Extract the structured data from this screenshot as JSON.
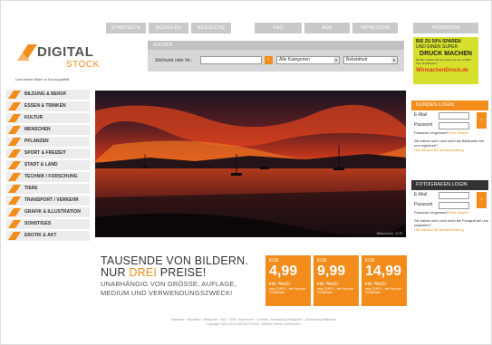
{
  "topnav": {
    "tabs": [
      "STARTSEITE",
      "BEZAHLEN",
      "BILDSUCHE",
      "FAQ",
      "AGB",
      "IMPRESSUM"
    ],
    "promo_tab": "PROMOTION"
  },
  "logo": {
    "word1": "DIGITAL",
    "word2": "STOCK",
    "tagline": "Lizenzfreie Bilder in Druckqualität"
  },
  "search": {
    "header": "SUCHEN",
    "label": "Stichwort oder Nr.:",
    "input_value": "",
    "category_select": "Alle Kategorien",
    "sort_select": "Beliebtheit"
  },
  "promo": {
    "line1": "BIS ZU 50% SPAREN",
    "line2": "UND EINEN SUPER",
    "line3": "DRUCK MACHEN",
    "line4": "Mit Wir-machen-Druck sparen Sie bis zu 50% Ihrer Druckkosten.",
    "brand": "WirmachenDruck.de"
  },
  "categories": [
    "BILDUNG & BERUF",
    "ESSEN & TRINKEN",
    "KULTUR",
    "MENSCHEN",
    "PFLANZEN",
    "SPORT & FREIZEIT",
    "STADT & LAND",
    "TECHNIK / FORSCHUNG",
    "TIERE",
    "TRANSPORT / VERKEHR",
    "GRAFIK & ILLUSTRATION",
    "SONSTIGES",
    "EROTIK & AKT"
  ],
  "hero": {
    "credit": "Bildnummer: 3178"
  },
  "kunden_login": {
    "header": "KUNDEN LOGIN",
    "email_label": "E-Mail",
    "password_label": "Passwort",
    "forgot": "Passwort vergessen?",
    "forgot_link": "Hier klicken",
    "info": "Sie haben sich noch nicht als Bildkunde bei uns registriert?",
    "info_link": "Hier klicken für Neuanmeldung"
  },
  "foto_login": {
    "header": "FOTOGRAFEN LOGIN",
    "email_label": "E-Mail",
    "password_label": "Passwort",
    "forgot": "Passwort vergessen?",
    "forgot_link": "Hier klicken",
    "info": "Sie haben sich noch nicht als Fotograf bei uns registriert?",
    "info_link": "Hier klicken für Neuanmeldung"
  },
  "claim": {
    "line1": "TAUSENDE VON BILDERN.",
    "line2a": "NUR ",
    "line2b": "DREI",
    "line2c": " PREISE!",
    "sub1": "UNABHÄNGIG VON GRÖSSE, AUFLAGE,",
    "sub2": "MEDIUM UND VERWENDUNGSZWECK!"
  },
  "prices": [
    {
      "currency": "EUR",
      "value": "4,99",
      "detail1": "inkl. MwSt.",
      "detail2": "zzgl. EUR 0,- bei Kauf per Kreditkarte"
    },
    {
      "currency": "EUR",
      "value": "9,99",
      "detail1": "inkl. MwSt.",
      "detail2": "zzgl. EUR 0,- bei Kauf per Kreditkarte"
    },
    {
      "currency": "EUR",
      "value": "14,99",
      "detail1": "inkl. MwSt.",
      "detail2": "zzgl. EUR 0,- bei Kauf per Kreditkarte"
    }
  ],
  "footer": {
    "links": "Startseite · Bezahlen · Bildsuche · FAQ · AGB · Impressum · Kontakt · Anmeldung Fotografen · Anmeldung Bildkunde",
    "copyright": "Copyright 2004-2010 DIGITALSTOCK. Weitere Rechte vorbehalten."
  },
  "colors": {
    "accent": "#f28c1b",
    "gray_tab": "#c7c9cb",
    "promo": "#d7e02d"
  }
}
